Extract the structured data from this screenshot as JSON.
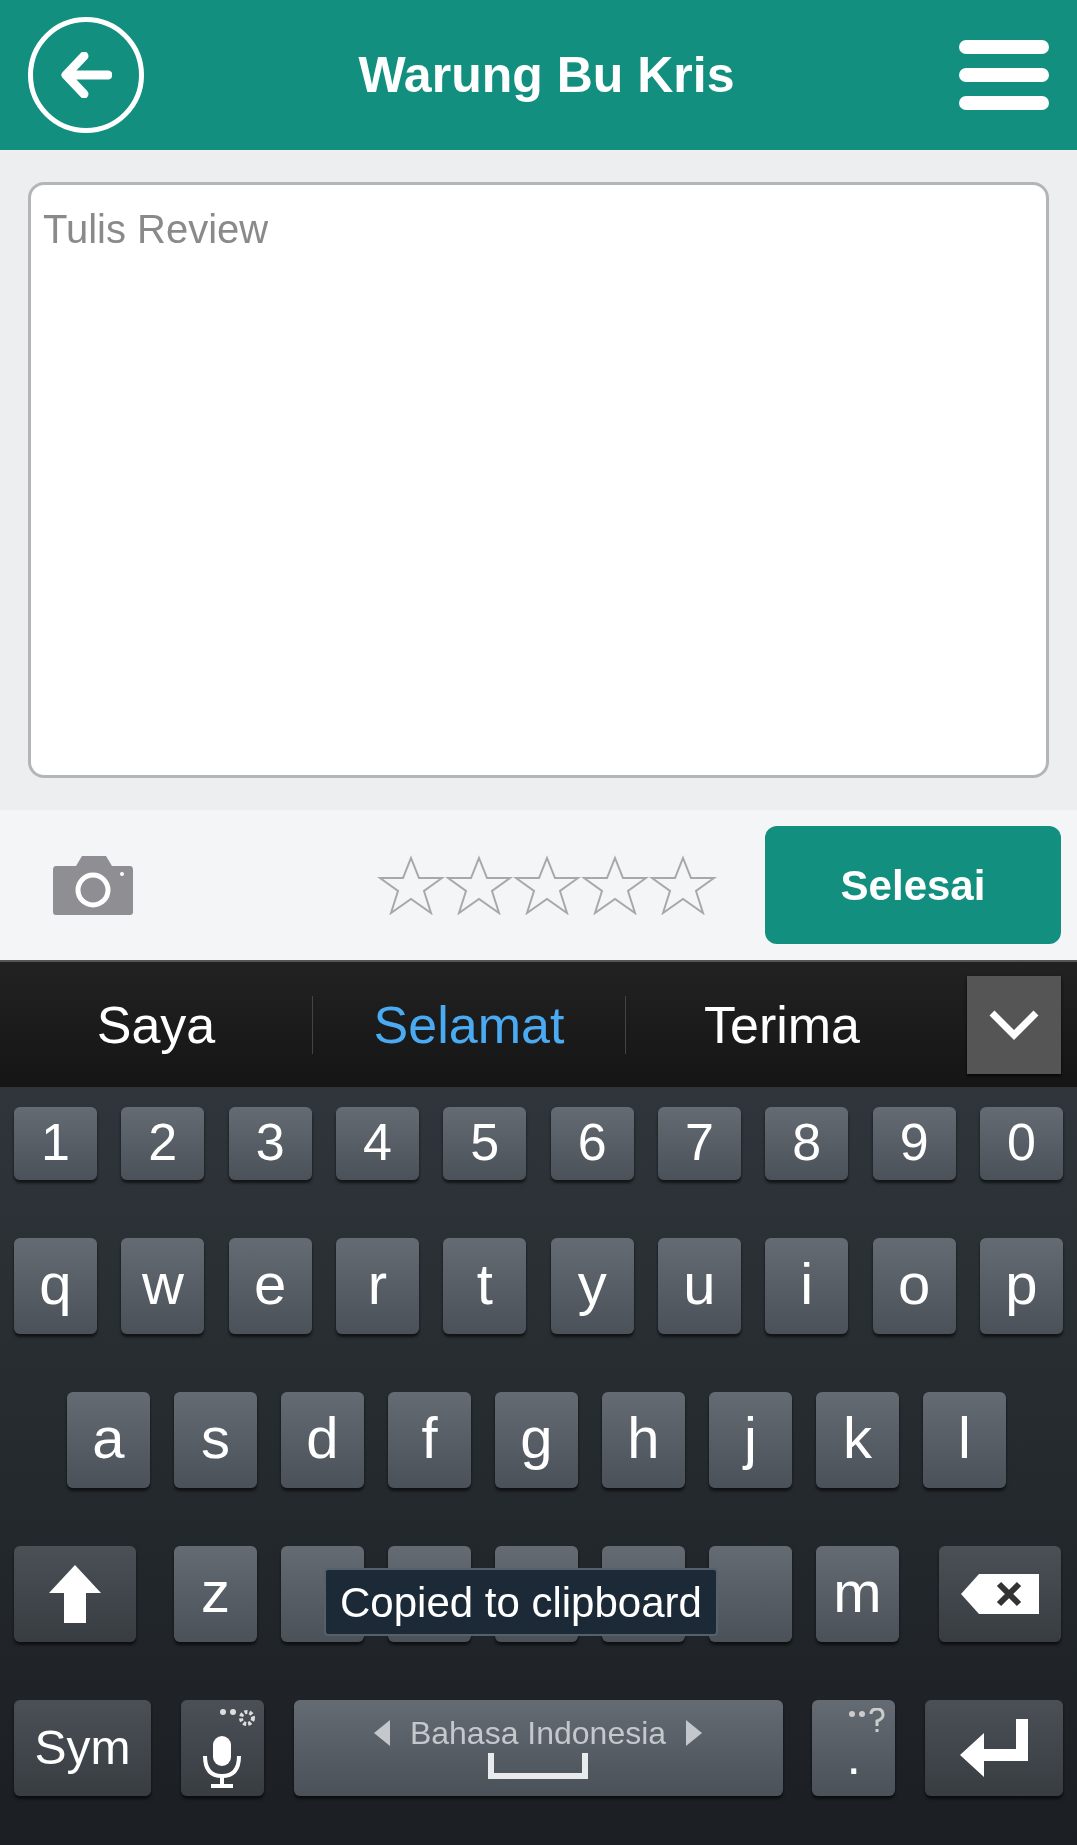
{
  "header": {
    "title": "Warung Bu Kris"
  },
  "review": {
    "placeholder": "Tulis Review"
  },
  "rating": {
    "stars": 0
  },
  "submit_button": "Selesai",
  "suggestions": [
    {
      "label": "Saya",
      "selected": false
    },
    {
      "label": "Selamat",
      "selected": true
    },
    {
      "label": "Terima",
      "selected": false
    }
  ],
  "keyboard": {
    "rows": [
      {
        "keys": [
          {
            "kind": "char",
            "label": "1"
          },
          {
            "kind": "char",
            "label": "2"
          },
          {
            "kind": "char",
            "label": "3"
          },
          {
            "kind": "char",
            "label": "4"
          },
          {
            "kind": "char",
            "label": "5"
          },
          {
            "kind": "char",
            "label": "6"
          },
          {
            "kind": "char",
            "label": "7"
          },
          {
            "kind": "char",
            "label": "8"
          },
          {
            "kind": "char",
            "label": "9"
          },
          {
            "kind": "char",
            "label": "0"
          }
        ]
      },
      {
        "keys": [
          {
            "kind": "char",
            "label": "q"
          },
          {
            "kind": "char",
            "label": "w"
          },
          {
            "kind": "char",
            "label": "e"
          },
          {
            "kind": "char",
            "label": "r"
          },
          {
            "kind": "char",
            "label": "t"
          },
          {
            "kind": "char",
            "label": "y"
          },
          {
            "kind": "char",
            "label": "u"
          },
          {
            "kind": "char",
            "label": "i"
          },
          {
            "kind": "char",
            "label": "o"
          },
          {
            "kind": "char",
            "label": "p"
          }
        ]
      },
      {
        "keys": [
          {
            "kind": "char",
            "label": "a"
          },
          {
            "kind": "char",
            "label": "s"
          },
          {
            "kind": "char",
            "label": "d"
          },
          {
            "kind": "char",
            "label": "f"
          },
          {
            "kind": "char",
            "label": "g"
          },
          {
            "kind": "char",
            "label": "h"
          },
          {
            "kind": "char",
            "label": "j"
          },
          {
            "kind": "char",
            "label": "k"
          },
          {
            "kind": "char",
            "label": "l"
          }
        ]
      },
      {
        "keys": [
          {
            "kind": "shift"
          },
          {
            "kind": "char",
            "label": "z"
          },
          {
            "kind": "covered"
          },
          {
            "kind": "covered"
          },
          {
            "kind": "covered"
          },
          {
            "kind": "covered"
          },
          {
            "kind": "covered"
          },
          {
            "kind": "char",
            "label": "m"
          },
          {
            "kind": "backspace"
          }
        ]
      },
      {
        "keys": [
          {
            "kind": "sym",
            "label": "Sym"
          },
          {
            "kind": "mic"
          },
          {
            "kind": "space",
            "label": "Bahasa Indonesia"
          },
          {
            "kind": "period",
            "label": "."
          },
          {
            "kind": "enter"
          }
        ]
      }
    ]
  },
  "toast": "Copied to clipboard"
}
